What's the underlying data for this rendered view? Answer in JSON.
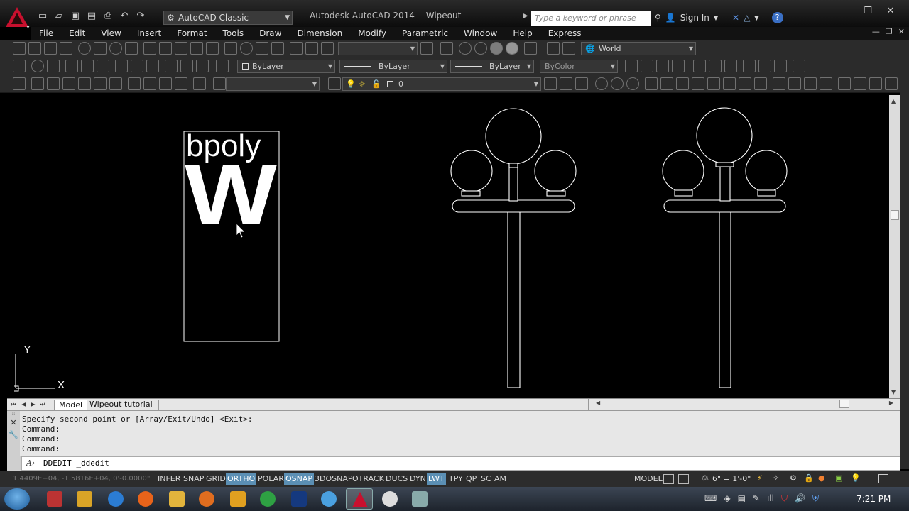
{
  "title_bar": {
    "workspace": "AutoCAD Classic",
    "app_name": "Autodesk AutoCAD 2014",
    "file_name": "Wipeout tutorial.dwg.dwg",
    "search_placeholder": "Type a keyword or phrase",
    "sign_in": "Sign In"
  },
  "menu": [
    "File",
    "Edit",
    "View",
    "Insert",
    "Format",
    "Tools",
    "Draw",
    "Dimension",
    "Modify",
    "Parametric",
    "Window",
    "Help",
    "Express"
  ],
  "toolbars": {
    "ucs_combo": "World",
    "color_combo": "ByLayer",
    "linetype_combo": "ByLayer",
    "lineweight_combo": "ByLayer",
    "plotstyle_combo": "ByColor",
    "layer_combo": "0"
  },
  "drawing": {
    "text_top": "bpoly",
    "text_big": "W",
    "ucs_x": "X",
    "ucs_y": "Y"
  },
  "tabs": {
    "model": "Model",
    "layout": "Wipeout tutorial"
  },
  "command": {
    "history": [
      "Specify second point or [Array/Exit/Undo] <Exit>:",
      "Command:",
      "Command:",
      "Command:"
    ],
    "input": "DDEDIT _ddedit"
  },
  "status": {
    "coords": "1.4409E+04, -1.5816E+04, 0'-0.0000\"",
    "toggles": [
      {
        "label": "INFER",
        "on": false
      },
      {
        "label": "SNAP",
        "on": false
      },
      {
        "label": "GRID",
        "on": false
      },
      {
        "label": "ORTHO",
        "on": true
      },
      {
        "label": "POLAR",
        "on": false
      },
      {
        "label": "OSNAP",
        "on": true
      },
      {
        "label": "3DOSNAP",
        "on": false
      },
      {
        "label": "OTRACK",
        "on": false
      },
      {
        "label": "DUCS",
        "on": false
      },
      {
        "label": "DYN",
        "on": false
      },
      {
        "label": "LWT",
        "on": true
      },
      {
        "label": "TPY",
        "on": false
      },
      {
        "label": "QP",
        "on": false
      },
      {
        "label": "SC",
        "on": false
      },
      {
        "label": "AM",
        "on": false
      }
    ],
    "space": "MODEL",
    "scale": "6\" = 1'-0\""
  },
  "taskbar": {
    "clock": "7:21 PM"
  }
}
